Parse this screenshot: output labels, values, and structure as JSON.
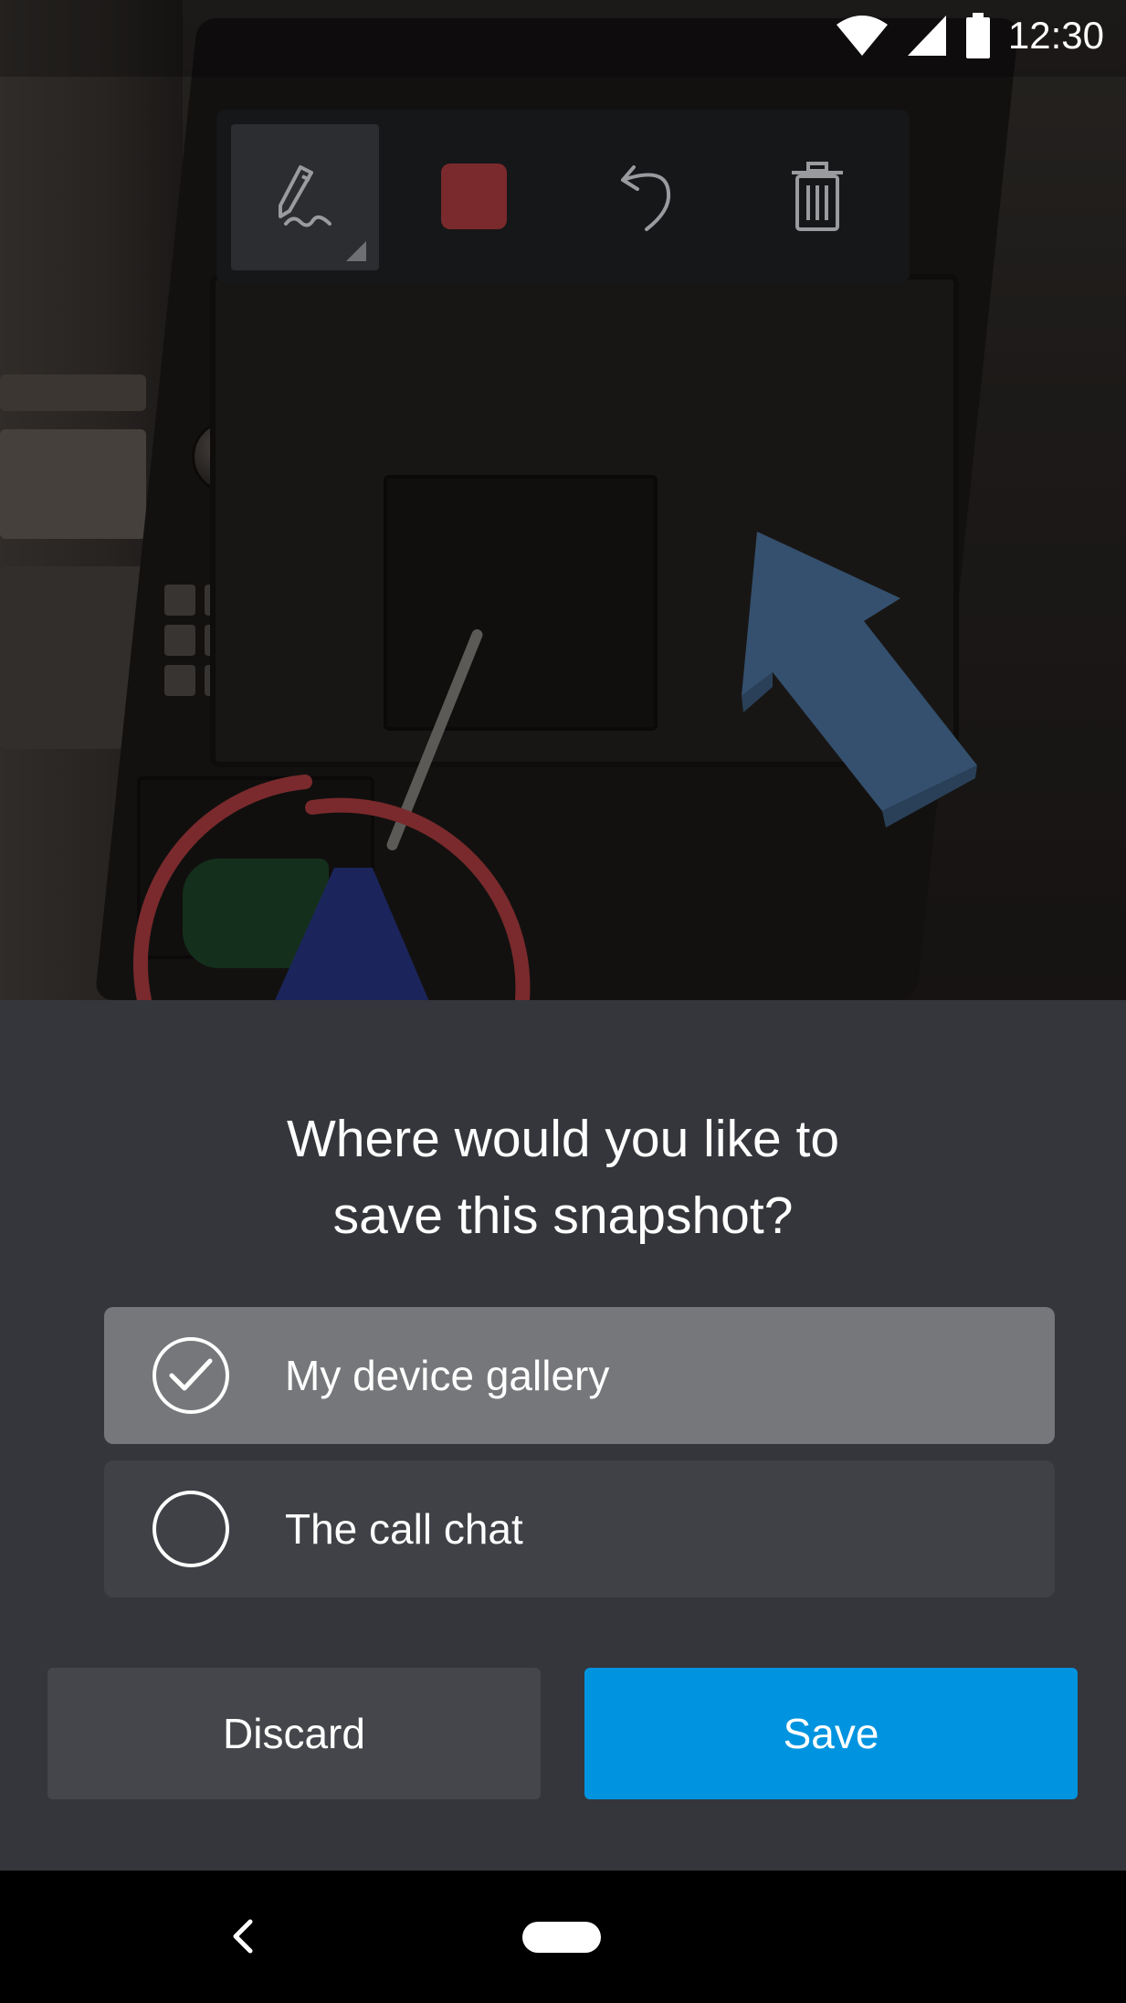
{
  "status_bar": {
    "time": "12:30",
    "icons": [
      "wifi-icon",
      "cellular-signal-icon",
      "battery-icon"
    ]
  },
  "toolbar": {
    "tools": [
      {
        "name": "pen-tool",
        "icon": "pen-icon",
        "active": true
      },
      {
        "name": "color-swatch",
        "icon": "color-square",
        "color": "#7a2a2c"
      },
      {
        "name": "undo",
        "icon": "undo-icon"
      },
      {
        "name": "delete",
        "icon": "trash-icon"
      }
    ]
  },
  "annotations": {
    "arrow_color": "#34506e",
    "circle_color": "#7a2a2c"
  },
  "dialog": {
    "title_line1": "Where would you like to",
    "title_line2": "save this snapshot?",
    "options": [
      {
        "label": "My device gallery",
        "selected": true
      },
      {
        "label": "The call chat",
        "selected": false
      }
    ],
    "discard_label": "Discard",
    "save_label": "Save"
  },
  "colors": {
    "sheet_background": "#35363b",
    "selected_option": "#76777b",
    "unselected_option": "#404146",
    "primary_button": "#0094e0",
    "secondary_button": "#45464b"
  },
  "nav_bar": {
    "icons": [
      "back-icon",
      "home-pill-icon"
    ]
  }
}
